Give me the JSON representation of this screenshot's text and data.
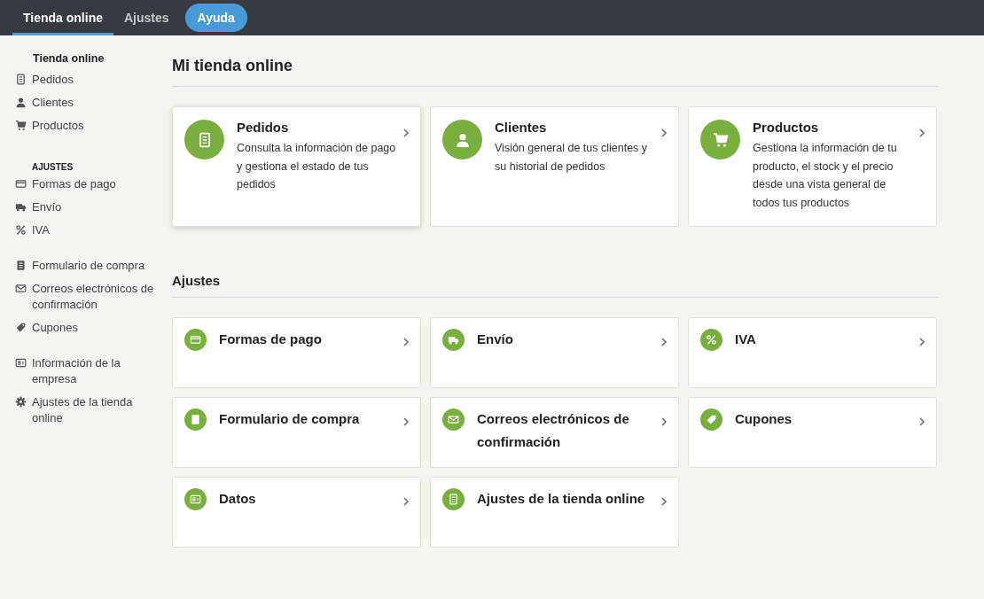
{
  "topbar": {
    "tabs": [
      {
        "label": "Tienda online",
        "kind": "tab",
        "selected": true
      },
      {
        "label": "Ajustes",
        "kind": "tab",
        "selected": false
      },
      {
        "label": "Ayuda",
        "kind": "pill",
        "selected": false
      }
    ]
  },
  "sidebar": {
    "sections": [
      {
        "heading": "Tienda online",
        "kind": "title",
        "items": [
          "Pedidos",
          "Clientes",
          "Productos"
        ]
      },
      {
        "heading": "AJUSTES",
        "kind": "caps",
        "items": [
          "Formas de pago",
          "Envío",
          "IVA"
        ]
      },
      {
        "items": [
          "Formulario de compra",
          "Correos electrónicos de confirmación",
          "Cupones"
        ]
      },
      {
        "items": [
          "Información de la empresa",
          "Ajustes de la tienda online"
        ]
      }
    ]
  },
  "overview": {
    "title": "Mi tienda online",
    "cards": [
      {
        "title": "Pedidos",
        "description": "Consulta la información de pago y gestiona el estado de tus pedidos"
      },
      {
        "title": "Clientes",
        "description": "Visión general de tus clientes y su historial de pedidos"
      },
      {
        "title": "Productos",
        "description": "Gestiona la información de tu producto, el stock y el precio desde una vista general de todos tus productos"
      }
    ]
  },
  "settings": {
    "title": "Ajustes",
    "cards": [
      {
        "title": "Formas de pago"
      },
      {
        "title": "Envío"
      },
      {
        "title": "IVA"
      },
      {
        "title": "Formulario de compra"
      },
      {
        "title": "Correos electrónicos de confirmación"
      },
      {
        "title": "Cupones"
      },
      {
        "title": "Datos"
      },
      {
        "title": "Ajustes de la tienda online"
      }
    ]
  }
}
